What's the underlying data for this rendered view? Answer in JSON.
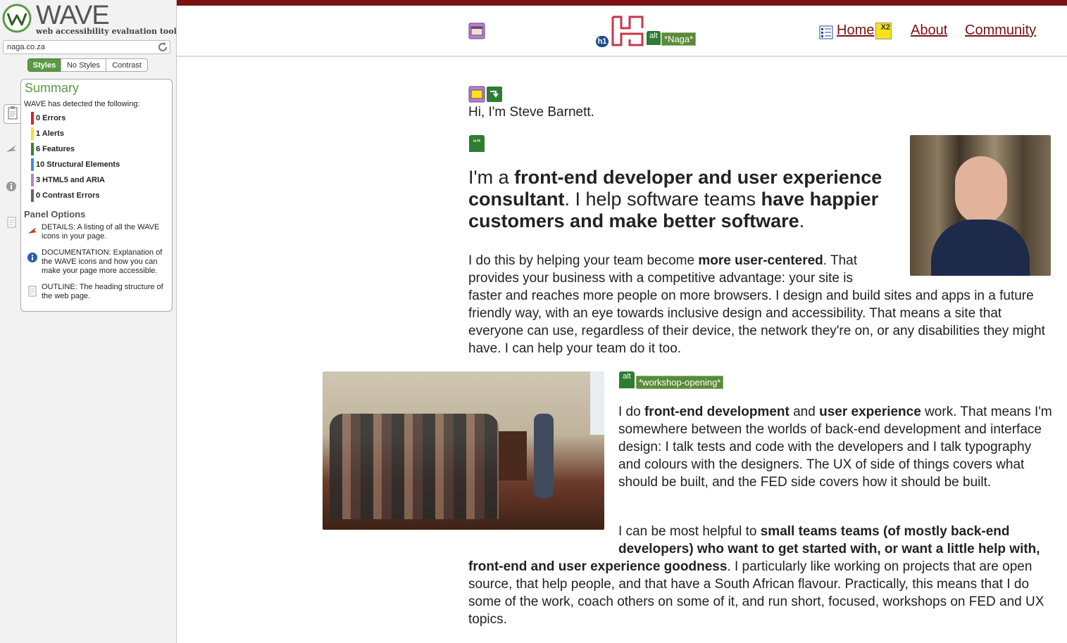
{
  "sidebar": {
    "app_name": "WAVE",
    "app_subtitle": "web accessibility evaluation tool",
    "url": "naga.co.za",
    "view_tabs": [
      "Styles",
      "No Styles",
      "Contrast"
    ],
    "summary": {
      "title": "Summary",
      "intro": "WAVE has detected the following:",
      "stats": [
        {
          "label": "0 Errors",
          "color": "#e31b23"
        },
        {
          "label": "1 Alerts",
          "color": "#f7e21c"
        },
        {
          "label": "6 Features",
          "color": "#2e8b2e"
        },
        {
          "label": "10 Structural Elements",
          "color": "#3d8fd6"
        },
        {
          "label": "3 HTML5 and ARIA",
          "color": "#b583c9"
        },
        {
          "label": "0 Contrast Errors",
          "color": "#666666"
        }
      ]
    },
    "panel_options": {
      "title": "Panel Options",
      "items": [
        {
          "icon": "details-flag-icon",
          "text": "DETAILS: A listing of all the WAVE icons in your page."
        },
        {
          "icon": "info-icon",
          "text": "DOCUMENTATION: Explanation of the WAVE icons and how you can make your page more accessible."
        },
        {
          "icon": "outline-document-icon",
          "text": "OUTLINE: The heading structure of the web page."
        }
      ]
    }
  },
  "site": {
    "accent": "#7b1113",
    "logo_alt": "*Naga*",
    "nav": [
      "Home",
      "About",
      "Community"
    ],
    "home_badge": "X2",
    "greeting": "Hi, I'm Steve Barnett.",
    "lead": {
      "p1": "I'm a ",
      "b1": "front-end developer and user experience consultant",
      "p2": ". I help software teams ",
      "b2": "have happier customers and make better software",
      "p3": "."
    },
    "para1": {
      "p1": "I do this by helping your team become ",
      "b1": "more user-centered",
      "p2": ". That provides your business with a competitive advantage: your site is faster and reaches more people on more browsers. I design and build sites and apps in a future friendly way, with an eye towards inclusive design and accessibility. That means a site that everyone can use, regardless of their device, the network they're on, or any disabilities they might have. I can help your team do it too."
    },
    "workshop_alt": "*workshop-opening*",
    "para2": {
      "p1": "I do ",
      "b1": "front-end development",
      "p2": " and ",
      "b2": "user experience",
      "p3": " work. That means I'm somewhere between the worlds of back-end development and interface design: I talk tests and code with the developers and I talk typography and colours with the designers. The UX of side of things covers what should be built, and the FED side covers how it should be built."
    },
    "para3": {
      "p1": "I can be most helpful to ",
      "b1": "small teams teams (of mostly back-end developers) who want to get started with, or want a little help with, front-end and user experience goodness",
      "p2": ". I particularly like working on projects that are open source, that help people, and that have a South African flavour. Practically, this means that I do some of the work, coach others on some of it, and run short, focused, workshops on FED and UX topics."
    }
  }
}
